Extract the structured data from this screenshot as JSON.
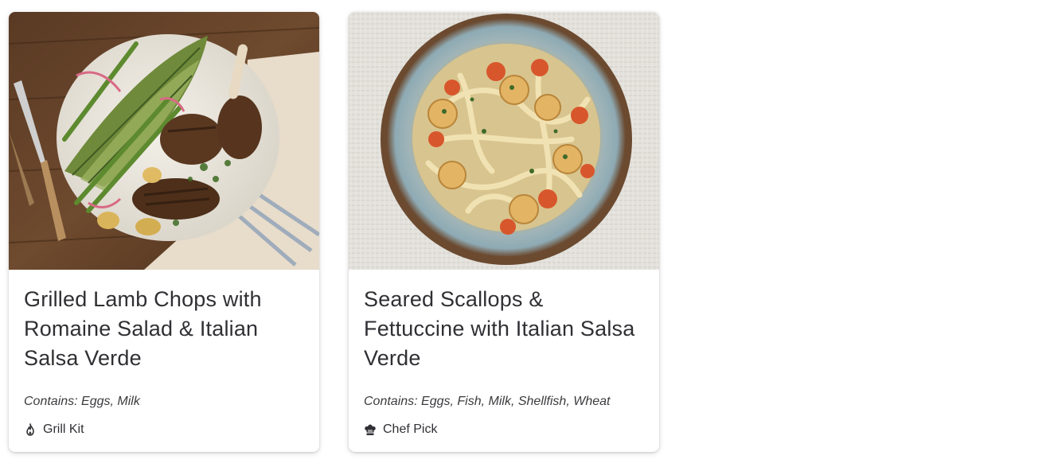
{
  "recipes": [
    {
      "title": "Grilled Lamb Chops with Romaine Salad & Italian Salsa Verde",
      "allergens": "Contains: Eggs, Milk",
      "badge": {
        "label": "Grill Kit",
        "icon": "flame-icon"
      },
      "image": "grilled-lamb-chops-photo"
    },
    {
      "title": "Seared Scallops & Fettuccine with Italian Salsa Verde",
      "allergens": "Contains: Eggs, Fish, Milk, Shellfish, Wheat",
      "badge": {
        "label": "Chef Pick",
        "icon": "chef-hat-icon"
      },
      "image": "seared-scallops-photo"
    }
  ],
  "colors": {
    "text": "#303034",
    "card_bg": "#ffffff",
    "page_bg": "#ffffff"
  }
}
